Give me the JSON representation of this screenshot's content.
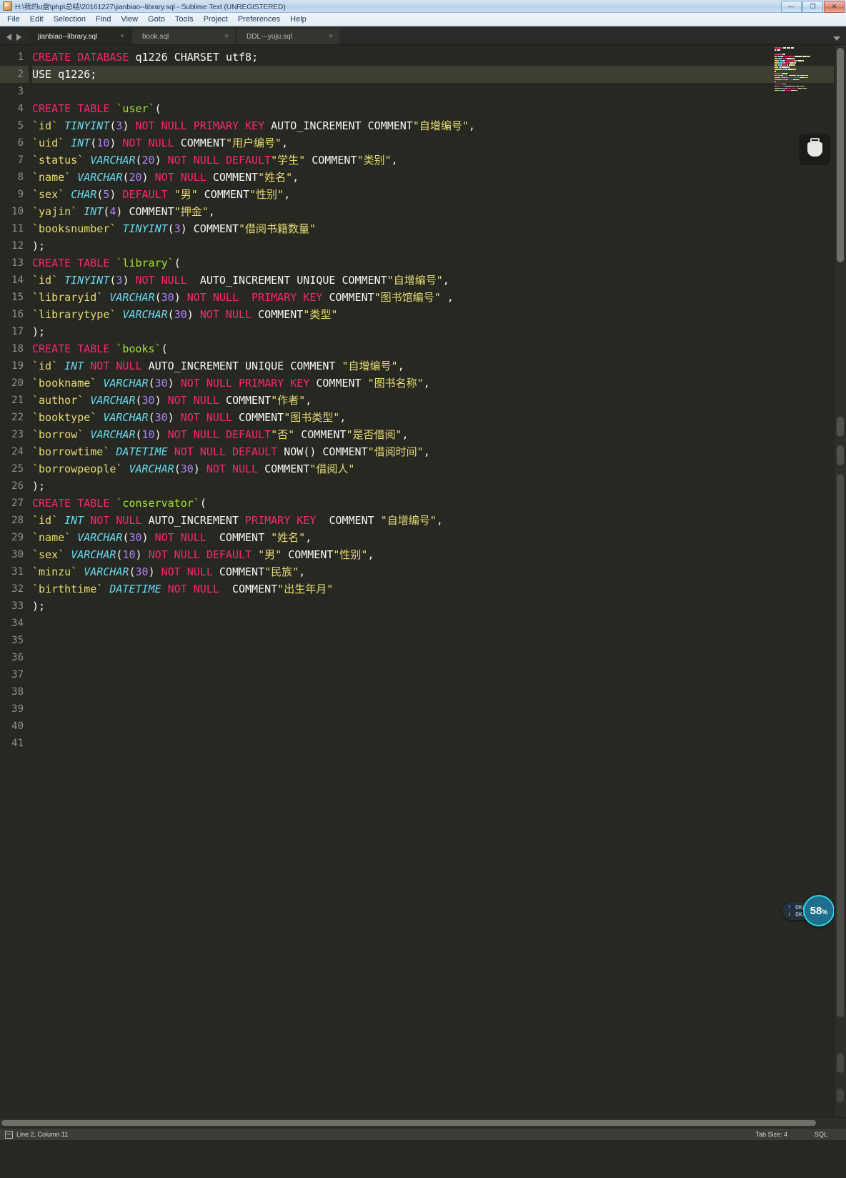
{
  "window": {
    "title": "H:\\我的u盘\\php\\总结\\20161227\\jianbiao--library.sql - Sublime Text (UNREGISTERED)",
    "minimize_label": "—",
    "maximize_label": "❐",
    "close_label": "✕"
  },
  "menubar": {
    "items": [
      {
        "label": "File"
      },
      {
        "label": "Edit"
      },
      {
        "label": "Selection"
      },
      {
        "label": "Find"
      },
      {
        "label": "View"
      },
      {
        "label": "Goto"
      },
      {
        "label": "Tools"
      },
      {
        "label": "Project"
      },
      {
        "label": "Preferences"
      },
      {
        "label": "Help"
      }
    ]
  },
  "tabs": [
    {
      "label": "jianbiao--library.sql",
      "close": "×",
      "active": true
    },
    {
      "label": "book.sql",
      "close": "×",
      "active": false
    },
    {
      "label": "DDL---yuju.sql",
      "close": "×",
      "active": false
    }
  ],
  "editor": {
    "current_line": 2,
    "total_gutter_lines": 41,
    "lines": [
      {
        "n": 1,
        "text": "CREATE DATABASE q1226 CHARSET utf8;"
      },
      {
        "n": 2,
        "text": "USE q1226;"
      },
      {
        "n": 3,
        "text": ""
      },
      {
        "n": 4,
        "text": "CREATE TABLE `user`("
      },
      {
        "n": 5,
        "text": "`id` TINYINT(3) NOT NULL PRIMARY KEY AUTO_INCREMENT COMMENT\"自增编号\","
      },
      {
        "n": 6,
        "text": "`uid` INT(10) NOT NULL COMMENT\"用户编号\","
      },
      {
        "n": 7,
        "text": "`status` VARCHAR(20) NOT NULL DEFAULT\"学生\" COMMENT\"类别\","
      },
      {
        "n": 8,
        "text": "`name` VARCHAR(20) NOT NULL COMMENT\"姓名\","
      },
      {
        "n": 9,
        "text": "`sex` CHAR(5) DEFAULT \"男\" COMMENT\"性别\","
      },
      {
        "n": 10,
        "text": "`yajin` INT(4) COMMENT\"押金\","
      },
      {
        "n": 11,
        "text": "`booksnumber` TINYINT(3) COMMENT\"借阅书籍数量\""
      },
      {
        "n": 12,
        "text": ");"
      },
      {
        "n": 13,
        "text": "CREATE TABLE `library`("
      },
      {
        "n": 14,
        "text": "`id` TINYINT(3) NOT NULL  AUTO_INCREMENT UNIQUE COMMENT\"自增编号\","
      },
      {
        "n": 15,
        "text": "`libraryid` VARCHAR(30) NOT NULL  PRIMARY KEY COMMENT\"图书馆编号\" ,"
      },
      {
        "n": 16,
        "text": "`librarytype` VARCHAR(30) NOT NULL COMMENT\"类型\""
      },
      {
        "n": 17,
        "text": ");"
      },
      {
        "n": 18,
        "text": "CREATE TABLE `books`("
      },
      {
        "n": 19,
        "text": "`id` INT NOT NULL AUTO_INCREMENT UNIQUE COMMENT \"自增编号\","
      },
      {
        "n": 20,
        "text": "`bookname` VARCHAR(30) NOT NULL PRIMARY KEY COMMENT \"图书名称\","
      },
      {
        "n": 21,
        "text": "`author` VARCHAR(30) NOT NULL COMMENT\"作者\","
      },
      {
        "n": 22,
        "text": "`booktype` VARCHAR(30) NOT NULL COMMENT\"图书类型\","
      },
      {
        "n": 23,
        "text": "`borrow` VARCHAR(10) NOT NULL DEFAULT\"否\" COMMENT\"是否借阅\","
      },
      {
        "n": 24,
        "text": "`borrowtime` DATETIME NOT NULL DEFAULT NOW() COMMENT\"借阅时间\","
      },
      {
        "n": 25,
        "text": "`borrowpeople` VARCHAR(30) NOT NULL COMMENT\"借阅人\""
      },
      {
        "n": 26,
        "text": ");"
      },
      {
        "n": 27,
        "text": "CREATE TABLE `conservator`("
      },
      {
        "n": 28,
        "text": "`id` INT NOT NULL AUTO_INCREMENT PRIMARY KEY  COMMENT \"自增编号\","
      },
      {
        "n": 29,
        "text": "`name` VARCHAR(30) NOT NULL  COMMENT \"姓名\","
      },
      {
        "n": 30,
        "text": "`sex` VARCHAR(10) NOT NULL DEFAULT \"男\" COMMENT\"性别\","
      },
      {
        "n": 31,
        "text": "`minzu` VARCHAR(30) NOT NULL COMMENT\"民族\","
      },
      {
        "n": 32,
        "text": "`birthtime` DATETIME NOT NULL  COMMENT\"出生年月\""
      },
      {
        "n": 33,
        "text": ");"
      },
      {
        "n": 34,
        "text": ""
      },
      {
        "n": 35,
        "text": ""
      },
      {
        "n": 36,
        "text": ""
      },
      {
        "n": 37,
        "text": ""
      },
      {
        "n": 38,
        "text": ""
      },
      {
        "n": 39,
        "text": ""
      },
      {
        "n": 40,
        "text": ""
      },
      {
        "n": 41,
        "text": ""
      }
    ],
    "colors": {
      "background": "#272822",
      "foreground": "#f8f8f2",
      "keyword": "#f92672",
      "type": "#66d9ef",
      "number": "#ae81ff",
      "string": "#e6db74",
      "identifier": "#a6e22e",
      "line_number": "#8f908a",
      "current_line_bg": "#3e3d32"
    }
  },
  "overlays": {
    "usb_icon": "usb-device-icon",
    "network": {
      "upload": "0K/s",
      "download": "0K/s",
      "upload_arrow": "↑",
      "download_arrow": "↓",
      "percent": "58",
      "percent_symbol": "%",
      "ring_color": "#2fd2e8"
    }
  },
  "statusbar": {
    "cursor_position": "Line 2, Column 11",
    "tab_size": "Tab Size: 4",
    "syntax": "SQL"
  }
}
